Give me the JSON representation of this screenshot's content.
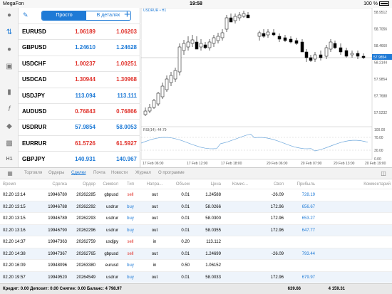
{
  "status": {
    "carrier": "MegaFon",
    "time": "19:58",
    "battery": "100 %"
  },
  "quotes": {
    "toolbar": {
      "simple": "Просто",
      "detailed": "В деталях"
    },
    "rows": [
      {
        "symbol": "EURUSD",
        "bid": "1.06189",
        "ask": "1.06203",
        "dir": "down"
      },
      {
        "symbol": "GBPUSD",
        "bid": "1.24610",
        "ask": "1.24628",
        "dir": "up"
      },
      {
        "symbol": "USDCHF",
        "bid": "1.00237",
        "ask": "1.00251",
        "dir": "down"
      },
      {
        "symbol": "USDCAD",
        "bid": "1.30944",
        "ask": "1.30968",
        "dir": "down"
      },
      {
        "symbol": "USDJPY",
        "bid": "113.094",
        "ask": "113.111",
        "dir": "up"
      },
      {
        "symbol": "AUDUSD",
        "bid": "0.76843",
        "ask": "0.76866",
        "dir": "down"
      },
      {
        "symbol": "USDRUR",
        "bid": "57.9854",
        "ask": "58.0053",
        "dir": "up"
      },
      {
        "symbol": "EURRUR",
        "bid": "61.5726",
        "ask": "61.5927",
        "dir": "down"
      },
      {
        "symbol": "GBPJPY",
        "bid": "140.931",
        "ask": "140.967",
        "dir": "up"
      }
    ]
  },
  "chart": {
    "title": "USDRUR • H1",
    "indicator": "RSI(14): 44.79",
    "price_ticks": [
      "58.9512",
      "58.7056",
      "58.4660",
      "58.2144",
      "57.9854",
      "57.7688",
      "57.5232"
    ],
    "current_price": "57.9854",
    "rsi_ticks": [
      "100.00",
      "70.00",
      "30.00",
      "0.00"
    ],
    "time_labels": [
      "17 Feb 06:00",
      "17 Feb 12:00",
      "17 Feb 18:00",
      "20 Feb 06:00",
      "20 Feb 07:00",
      "20 Feb 13:00",
      "20 Feb 19:00"
    ],
    "colors": {
      "rsi": "#6fa8dc",
      "bull": "#ffffff",
      "bear": "#000000"
    }
  },
  "tabs": [
    "Торговля",
    "Ордеры",
    "Сделки",
    "Почта",
    "Новости",
    "Журнал",
    "О программе"
  ],
  "active_tab": "Сделки",
  "table": {
    "headers": [
      "Время",
      "Сделка",
      "Ордер",
      "Символ",
      "Тип",
      "Напра...",
      "Объем",
      "Цена",
      "Комис...",
      "Своп",
      "Прибыль",
      "Комментарий"
    ],
    "rows": [
      [
        "02.20 13:14",
        "19946780",
        "20262285",
        "gbpusd",
        "sell",
        "out",
        "0.01",
        "1.24588",
        "",
        "-26.09",
        "728.19",
        ""
      ],
      [
        "02.20 13:15",
        "19946788",
        "20262292",
        "usdrur",
        "buy",
        "out",
        "0.01",
        "58.0266",
        "",
        "172.96",
        "656.67",
        ""
      ],
      [
        "02.20 13:15",
        "19946789",
        "20262293",
        "usdrur",
        "buy",
        "out",
        "0.01",
        "58.0300",
        "",
        "172.96",
        "653.27",
        ""
      ],
      [
        "02.20 13:16",
        "19946790",
        "20262296",
        "usdrur",
        "buy",
        "out",
        "0.01",
        "58.0355",
        "",
        "172.96",
        "647.77",
        ""
      ],
      [
        "02.20 14:37",
        "19947363",
        "20262759",
        "usdjpy",
        "sell",
        "in",
        "0.20",
        "113.112",
        "",
        "",
        "",
        ""
      ],
      [
        "02.20 14:38",
        "19947367",
        "20262765",
        "gbpusd",
        "sell",
        "out",
        "0.01",
        "1.24699",
        "",
        "-26.09",
        "793.44",
        ""
      ],
      [
        "02.20 16:09",
        "19948096",
        "20263380",
        "eurusd",
        "buy",
        "in",
        "0.50",
        "1.06152",
        "",
        "",
        "",
        ""
      ],
      [
        "02.20 19:57",
        "19949520",
        "20264549",
        "usdrur",
        "buy",
        "out",
        "0.01",
        "58.0033",
        "",
        "172.96",
        "679.97",
        ""
      ]
    ]
  },
  "footer": {
    "summary": "Кредит: 0.00 Депозит: 0.00 Снятие: 0.00 Баланс: 4 798.97",
    "swap_total": "639.66",
    "profit_total": "4 159.31"
  }
}
